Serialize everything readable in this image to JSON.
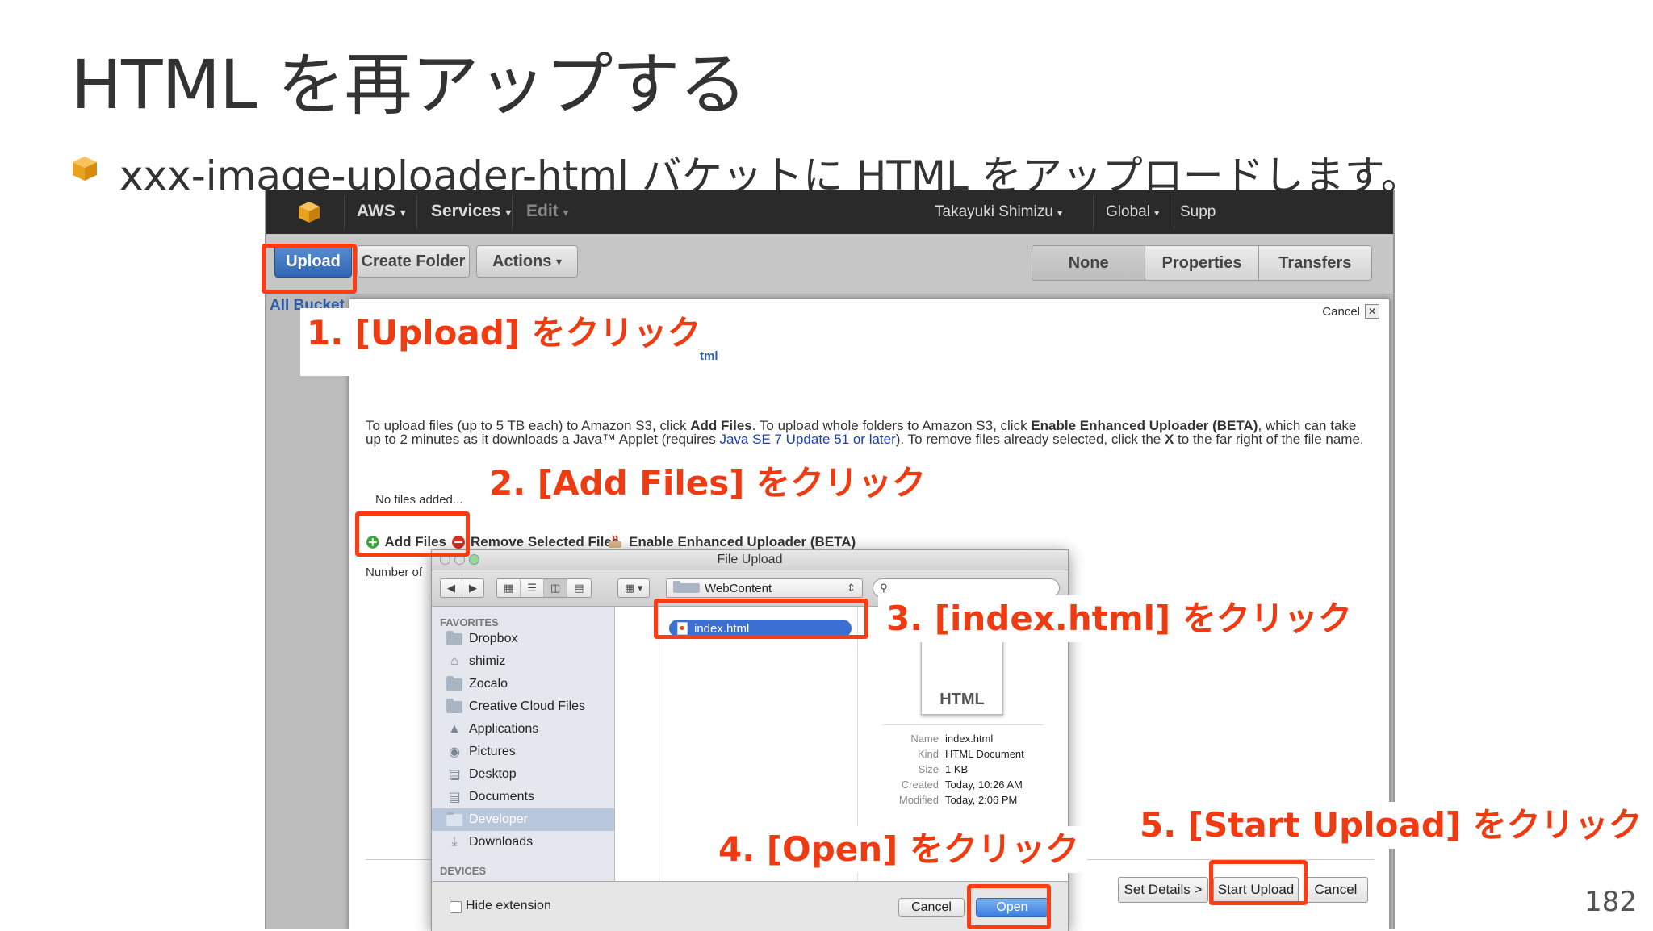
{
  "slide": {
    "title": "HTML を再アップする",
    "bullet": "xxx-image-uploader-html バケットに HTML をアップロードします。",
    "page_number": "182"
  },
  "aws_nav": {
    "aws": "AWS",
    "services": "Services",
    "edit": "Edit",
    "user": "Takayuki Shimizu",
    "region": "Global",
    "support": "Supp"
  },
  "toolbar": {
    "upload": "Upload",
    "create_folder": "Create Folder",
    "actions": "Actions",
    "views": [
      "None",
      "Properties",
      "Transfers"
    ]
  },
  "breadcrumb": "All Bucket",
  "upload_panel": {
    "cancel": "Cancel",
    "bucket_fragment": "tml",
    "instr_1": "To upload files (up to 5 TB each) to Amazon S3, click ",
    "instr_add": "Add Files",
    "instr_2": ". To upload whole folders to Amazon S3, click ",
    "instr_enh": "Enable Enhanced Uploader (BETA)",
    "instr_3": ", which can take up to 2 minutes as it downloads a Java™ Applet (requires ",
    "instr_link": "Java SE 7 Update 51 or later",
    "instr_4": "). To remove files already selected, click the ",
    "instr_x": "X",
    "instr_5": " to the far right of the file name.",
    "no_files": "No files added...",
    "add_files": "Add Files",
    "remove_selected": "Remove Selected Files",
    "enhanced": "Enable Enhanced Uploader (BETA)",
    "number_of": "Number of",
    "set_details": "Set Details >",
    "start_upload": "Start Upload",
    "cancel_bottom": "Cancel"
  },
  "file_dialog": {
    "title": "File Upload",
    "location": "WebContent",
    "favorites_head": "FAVORITES",
    "favorites": [
      "Dropbox",
      "shimiz",
      "Zocalo",
      "Creative Cloud Files",
      "Applications",
      "Pictures",
      "Desktop",
      "Documents",
      "Developer",
      "Downloads"
    ],
    "devices_head": "DEVICES",
    "selected_file": "index.html",
    "preview_label": "HTML",
    "meta": [
      {
        "k": "Name",
        "v": "index.html"
      },
      {
        "k": "Kind",
        "v": "HTML Document"
      },
      {
        "k": "Size",
        "v": "1 KB"
      },
      {
        "k": "Created",
        "v": "Today, 10:26 AM"
      },
      {
        "k": "Modified",
        "v": "Today, 2:06 PM"
      }
    ],
    "hide_extension": "Hide extension",
    "cancel": "Cancel",
    "open": "Open"
  },
  "callouts": {
    "step1": "1. [Upload] をクリック",
    "step2": "2. [Add Files] をクリック",
    "step3": "3. [index.html] をクリック",
    "step4": "4. [Open] をクリック",
    "step5": "5. [Start Upload] をクリック"
  },
  "colors": {
    "highlight": "#ff3b12",
    "callout_text": "#ee3b12",
    "aws_bar": "#2a2a2a",
    "upload_button": "#2e66b3",
    "link": "#1a3dbf"
  }
}
